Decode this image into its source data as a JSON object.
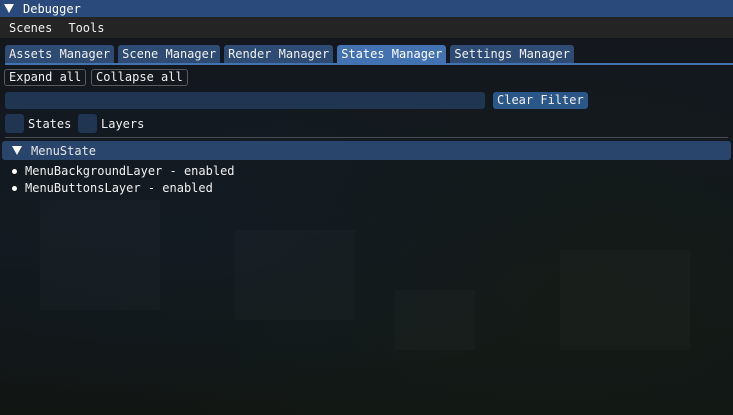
{
  "window": {
    "title": "Debugger"
  },
  "menubar": {
    "items": [
      "Scenes",
      "Tools"
    ]
  },
  "tabs": [
    {
      "label": "Assets Manager",
      "active": false
    },
    {
      "label": "Scene Manager",
      "active": false
    },
    {
      "label": "Render Manager",
      "active": false
    },
    {
      "label": "States Manager",
      "active": true
    },
    {
      "label": "Settings Manager",
      "active": false
    }
  ],
  "toolbar": {
    "expand_all": "Expand all",
    "collapse_all": "Collapse all",
    "clear_filter": "Clear Filter"
  },
  "filter": {
    "value": "",
    "placeholder": ""
  },
  "checkboxes": [
    {
      "label": "States",
      "checked": false
    },
    {
      "label": "Layers",
      "checked": false
    }
  ],
  "tree": {
    "header": "MenuState",
    "expanded": true,
    "items": [
      "MenuBackgroundLayer - enabled",
      "MenuButtonsLayer - enabled"
    ]
  },
  "colors": {
    "titlebar": "#294a7a",
    "tab": "#2d4b73",
    "tab_active": "#4272b0",
    "button": "#2b5688",
    "frame": "#1f3552"
  }
}
